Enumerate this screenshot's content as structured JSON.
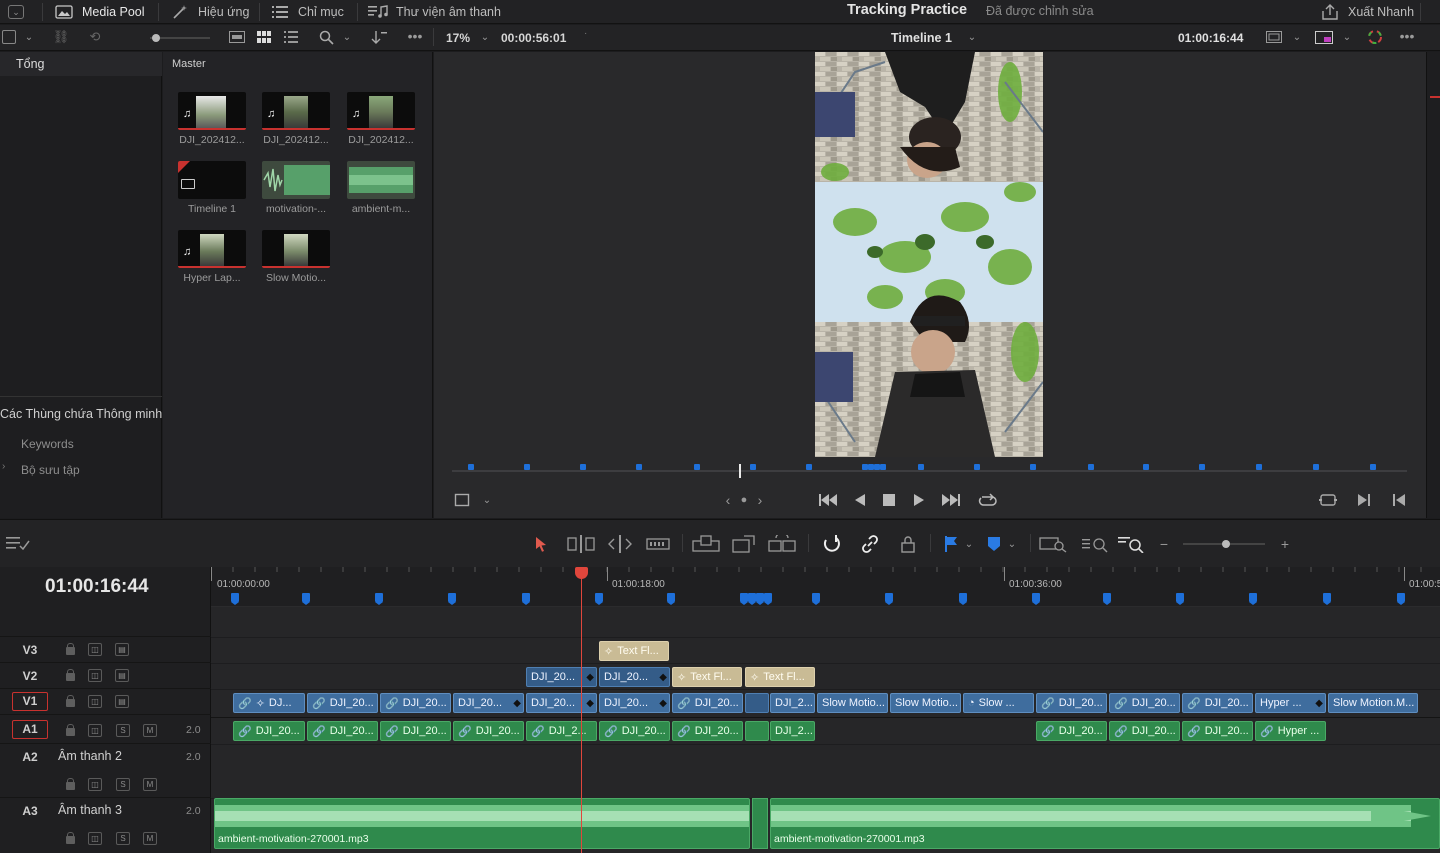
{
  "menu": {
    "media_pool": "Media Pool",
    "effects": "Hiệu ứng",
    "index": "Chỉ mục",
    "sound_library": "Thư viện âm thanh",
    "export": "Xuất Nhanh"
  },
  "project": {
    "title": "Tracking Practice",
    "status": "Đã được chỉnh sửa"
  },
  "viewer": {
    "zoom": "17%",
    "source_timecode": "00:00:56:01",
    "timeline_name": "Timeline 1",
    "record_timecode": "01:00:16:44"
  },
  "bins": {
    "root": "Tổng",
    "smart_bins_title": "Các Thùng chứa Thông minh",
    "keywords": "Keywords",
    "collections": "Bộ sưu tập"
  },
  "media_pool": {
    "folder": "Master",
    "items": [
      {
        "label": "DJI_202412..."
      },
      {
        "label": "DJI_202412..."
      },
      {
        "label": "DJI_202412..."
      },
      {
        "label": "Timeline 1"
      },
      {
        "label": "motivation-..."
      },
      {
        "label": "ambient-m..."
      },
      {
        "label": "Hyper Lap..."
      },
      {
        "label": "Slow Motio..."
      }
    ]
  },
  "timeline": {
    "timecode": "01:00:16:44",
    "ruler": [
      "01:00:00:00",
      "01:00:18:00",
      "01:00:36:00",
      "01:00:5"
    ],
    "tracks": {
      "v3": "V3",
      "v2": "V2",
      "v1": "V1",
      "a1": "A1",
      "a2": "A2",
      "a2_name": "Âm thanh 2",
      "a3": "A3",
      "a3_name": "Âm thanh 3",
      "a1_vol": "2.0",
      "a2_vol": "2.0",
      "a3_vol": "2.0",
      "solo": "S",
      "mute": "M"
    },
    "clips": {
      "v3": [
        {
          "label": "Text Fl..."
        }
      ],
      "v2": [
        {
          "label": "DJI_20..."
        },
        {
          "label": "DJI_20..."
        },
        {
          "label": "Text Fl..."
        },
        {
          "label": "Text Fl..."
        }
      ],
      "v1": [
        {
          "label": "DJ..."
        },
        {
          "label": "DJI_20..."
        },
        {
          "label": "DJI_20..."
        },
        {
          "label": "DJI_20..."
        },
        {
          "label": "DJI_20..."
        },
        {
          "label": "DJI_20..."
        },
        {
          "label": "DJI_20..."
        },
        {
          "label": "DJI_2..."
        },
        {
          "label": "Slow Motio..."
        },
        {
          "label": "Slow Motio..."
        },
        {
          "label": "Slow ..."
        },
        {
          "label": "DJI_20..."
        },
        {
          "label": "DJI_20..."
        },
        {
          "label": "DJI_20..."
        },
        {
          "label": "Hyper ..."
        },
        {
          "label": "Slow Motion.M..."
        }
      ],
      "a1": [
        {
          "label": "DJI_20..."
        },
        {
          "label": "DJI_20..."
        },
        {
          "label": "DJI_20..."
        },
        {
          "label": "DJI_20..."
        },
        {
          "label": "DJI_2..."
        },
        {
          "label": "DJI_20..."
        },
        {
          "label": "DJI_20..."
        },
        {
          "label": "DJI_2..."
        },
        {
          "label": "DJI_20..."
        },
        {
          "label": "DJI_20..."
        },
        {
          "label": "DJI_20..."
        },
        {
          "label": "Hyper ..."
        }
      ],
      "a3": [
        {
          "label": "ambient-motivation-270001.mp3"
        },
        {
          "label": "ambient-motivation-270001.mp3"
        }
      ]
    }
  }
}
